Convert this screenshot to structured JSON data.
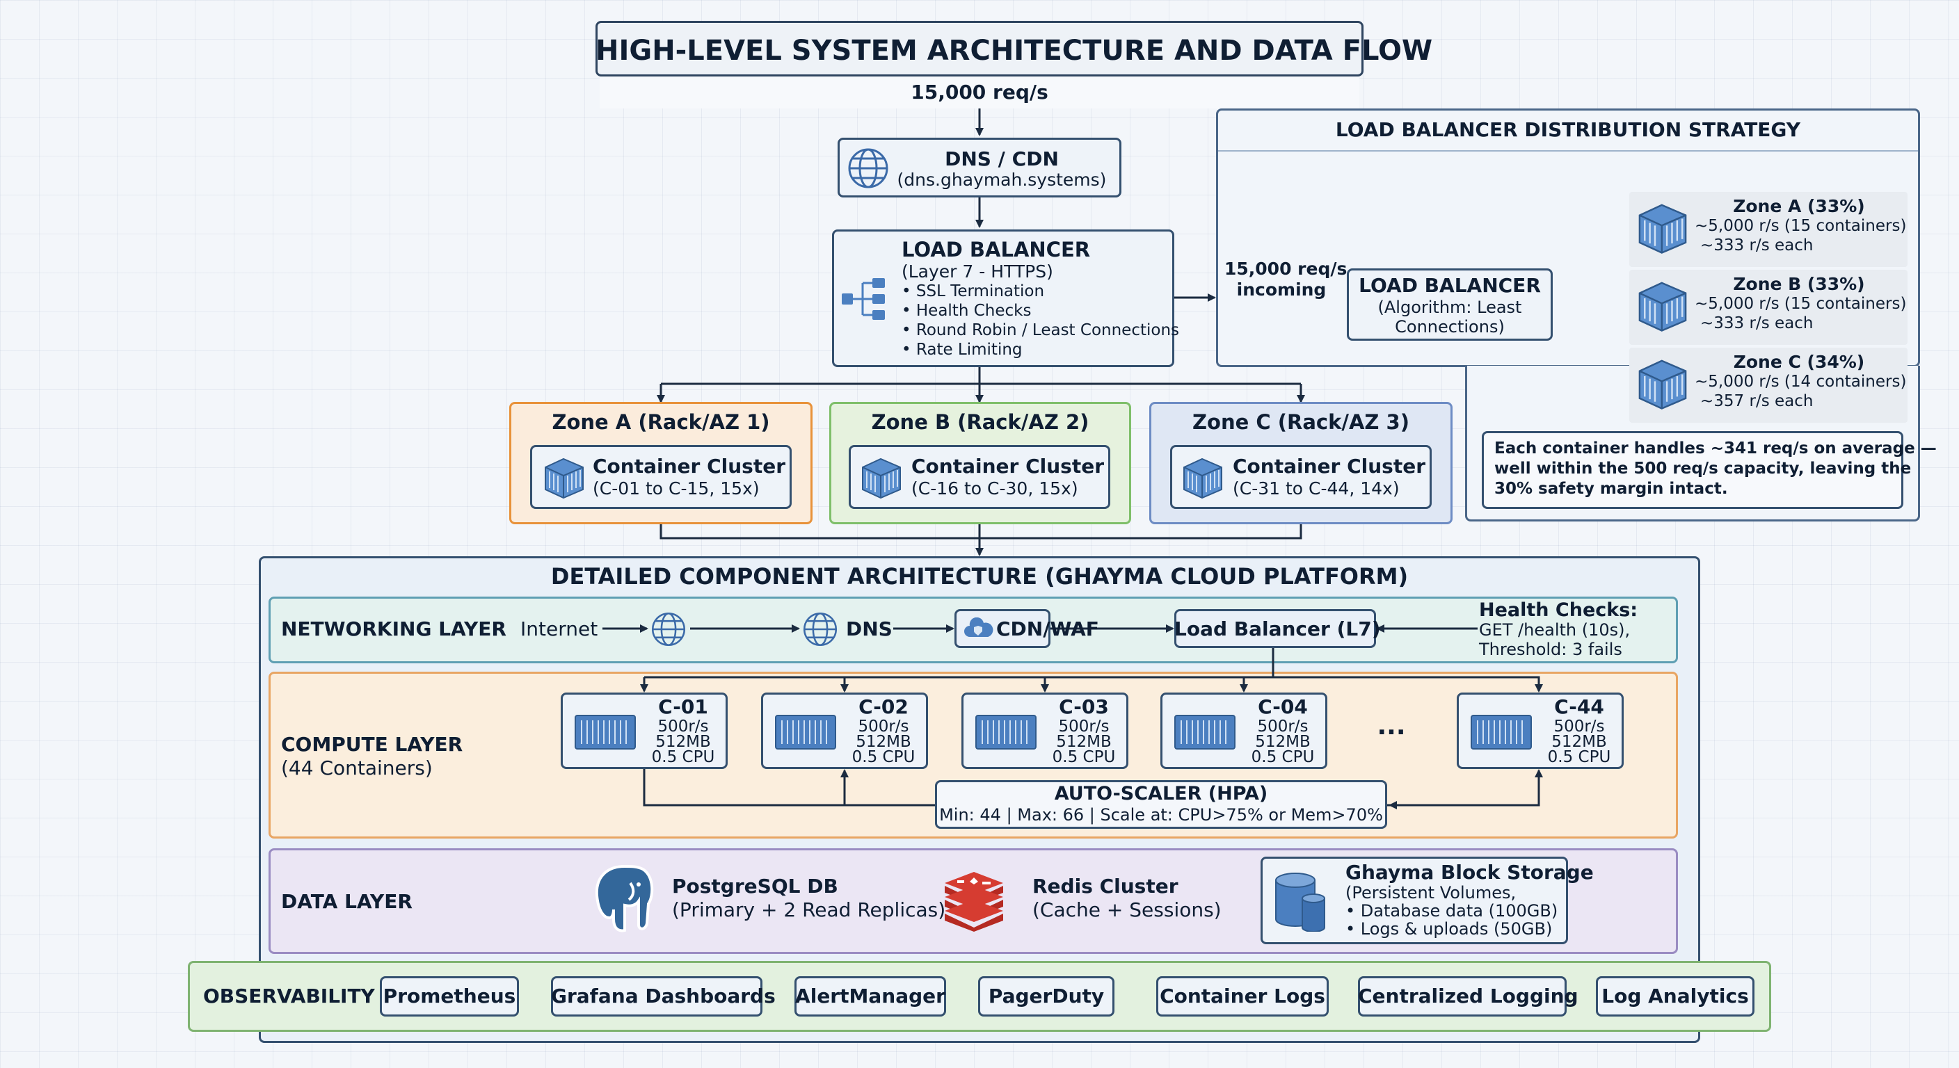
{
  "title": "HIGH-LEVEL SYSTEM ARCHITECTURE AND DATA FLOW",
  "incoming_rate": "15,000 req/s",
  "dns": {
    "title": "DNS / CDN",
    "domain": "(dns.ghaymah.systems)"
  },
  "load_balancer": {
    "title": "LOAD BALANCER",
    "subtitle": "(Layer 7 - HTTPS)",
    "features": [
      "• SSL Termination",
      "• Health Checks",
      "• Round Robin / Least Connections",
      "• Rate Limiting"
    ]
  },
  "zones": [
    {
      "title": "Zone A (Rack/AZ 1)",
      "cluster": "Container Cluster",
      "range": "(C-01 to C-15, 15x)",
      "color": "#e8923a",
      "bg": "#fbecdc"
    },
    {
      "title": "Zone B (Rack/AZ 2)",
      "cluster": "Container Cluster",
      "range": "(C-16 to C-30, 15x)",
      "color": "#7fbf6a",
      "bg": "#e6f2de"
    },
    {
      "title": "Zone C (Rack/AZ 3)",
      "cluster": "Container Cluster",
      "range": "(C-31 to C-44, 14x)",
      "color": "#6d8cc4",
      "bg": "#dfe7f4"
    }
  ],
  "strategy": {
    "title": "LOAD BALANCER DISTRIBUTION STRATEGY",
    "incoming_line1": "15,000 req/s",
    "incoming_line2": "incoming",
    "lb_title": "LOAD BALANCER",
    "lb_algo1": "(Algorithm: Least",
    "lb_algo2": "Connections)",
    "zones": [
      {
        "title": "Zone A (33%)",
        "line1": "~5,000 r/s (15 containers)",
        "line2": "~333 r/s each"
      },
      {
        "title": "Zone B (33%)",
        "line1": "~5,000 r/s (15 containers)",
        "line2": "~333 r/s each"
      },
      {
        "title": "Zone C (34%)",
        "line1": "~5,000 r/s (14 containers)",
        "line2": "~357 r/s each"
      }
    ],
    "note": [
      "Each container handles ~341 req/s on average —",
      "well within the 500 req/s capacity, leaving the",
      "30% safety margin intact."
    ]
  },
  "detail_title": "DETAILED COMPONENT ARCHITECTURE (GHAYMA CLOUD PLATFORM)",
  "networking": {
    "label": "NETWORKING LAYER",
    "internet": "Internet",
    "dns": "DNS",
    "cdn": "CDN/WAF",
    "lb": "Load Balancer (L7)",
    "health_title": "Health Checks:",
    "health_line1": "GET /health (10s),",
    "health_line2": "Threshold: 3 fails"
  },
  "compute": {
    "label": "COMPUTE LAYER",
    "sublabel": "(44 Containers)",
    "containers": [
      {
        "id": "C-01",
        "rate": "500r/s",
        "mem": "512MB",
        "cpu": "0.5 CPU"
      },
      {
        "id": "C-02",
        "rate": "500r/s",
        "mem": "512MB",
        "cpu": "0.5 CPU"
      },
      {
        "id": "C-03",
        "rate": "500r/s",
        "mem": "512MB",
        "cpu": "0.5 CPU"
      },
      {
        "id": "C-04",
        "rate": "500r/s",
        "mem": "512MB",
        "cpu": "0.5 CPU"
      },
      {
        "id": "C-44",
        "rate": "500r/s",
        "mem": "512MB",
        "cpu": "0.5 CPU"
      }
    ],
    "ellipsis": "...",
    "autoscaler_title": "AUTO-SCALER (HPA)",
    "autoscaler_detail": "Min: 44 | Max: 66 | Scale at: CPU>75% or Mem>70%"
  },
  "data_layer": {
    "label": "DATA LAYER",
    "pg_title": "PostgreSQL DB",
    "pg_sub": "(Primary + 2 Read Replicas)",
    "redis_title": "Redis Cluster",
    "redis_sub": "(Cache + Sessions)",
    "storage_title": "Ghayma Block Storage",
    "storage_sub": "(Persistent Volumes,",
    "storage_l1": "• Database data (100GB)",
    "storage_l2": "• Logs & uploads (50GB)"
  },
  "observability": {
    "label": "OBSERVABILITY",
    "chain1": [
      "Prometheus",
      "Grafana Dashboards",
      "AlertManager",
      "PagerDuty"
    ],
    "chain2": [
      "Container Logs",
      "Centralized Logging",
      "Log Analytics"
    ]
  },
  "colors": {
    "border": "#34506f",
    "box_bg": "#e9f0f8",
    "net_bg": "#e4f2ef",
    "net_border": "#5f9fb3",
    "compute_bg": "#fbeedd",
    "compute_border": "#e8a563",
    "data_bg": "#ebe6f4",
    "data_border": "#9a8cc2",
    "obs_bg": "#e3f1df",
    "obs_border": "#7fb371",
    "icon_blue": "#4b7fc0",
    "redis_red": "#d63c31",
    "pg_blue": "#33679a"
  }
}
